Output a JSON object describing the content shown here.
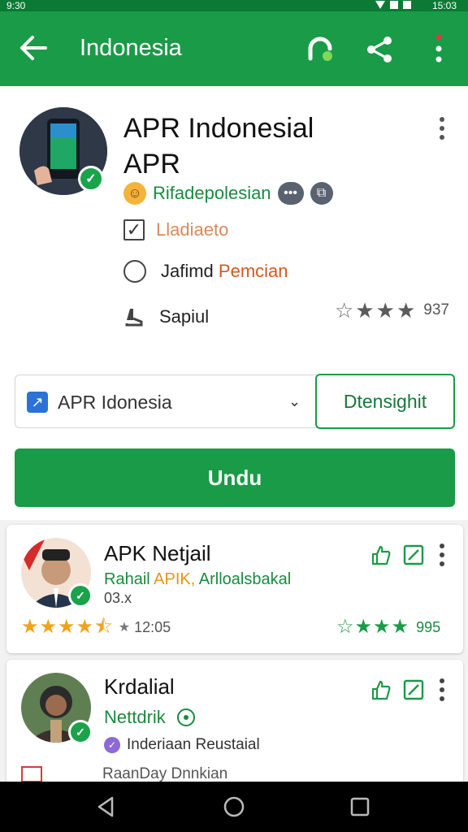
{
  "status_bar": {
    "left": "9:30",
    "time": "15:03"
  },
  "app_bar": {
    "title": "Indonesia"
  },
  "app": {
    "title": "APR Indonesial APR",
    "developer": "Rifadepolesian",
    "checkbox_label": "Lladiaeto",
    "radio_label_1": "Jafimd",
    "radio_label_2": "Pemcian",
    "support_label": "Sapiul",
    "rating_count": "937"
  },
  "selector": {
    "value": "APR Idonesia",
    "button": "Dtensighit"
  },
  "install_button": "Undu",
  "cards": [
    {
      "title": "APK Netjail",
      "sub_1": "Rahail",
      "sub_2": "APIK,",
      "sub_3": "Arlloalsbakal",
      "meta": "03.x",
      "stars": "4.5",
      "time": "12:05",
      "count": "995"
    },
    {
      "title": "Krdalial",
      "sub": "Nettdrik",
      "tag": "Inderiaan Reustaial",
      "footer": "RaanDay Dnnkian"
    }
  ],
  "colors": {
    "primary": "#1a9b47",
    "developer_green": "#1a8a3e",
    "accent_orange": "#e69419",
    "star_gold": "#f0a21b",
    "star_gray": "#7a7a7a"
  }
}
